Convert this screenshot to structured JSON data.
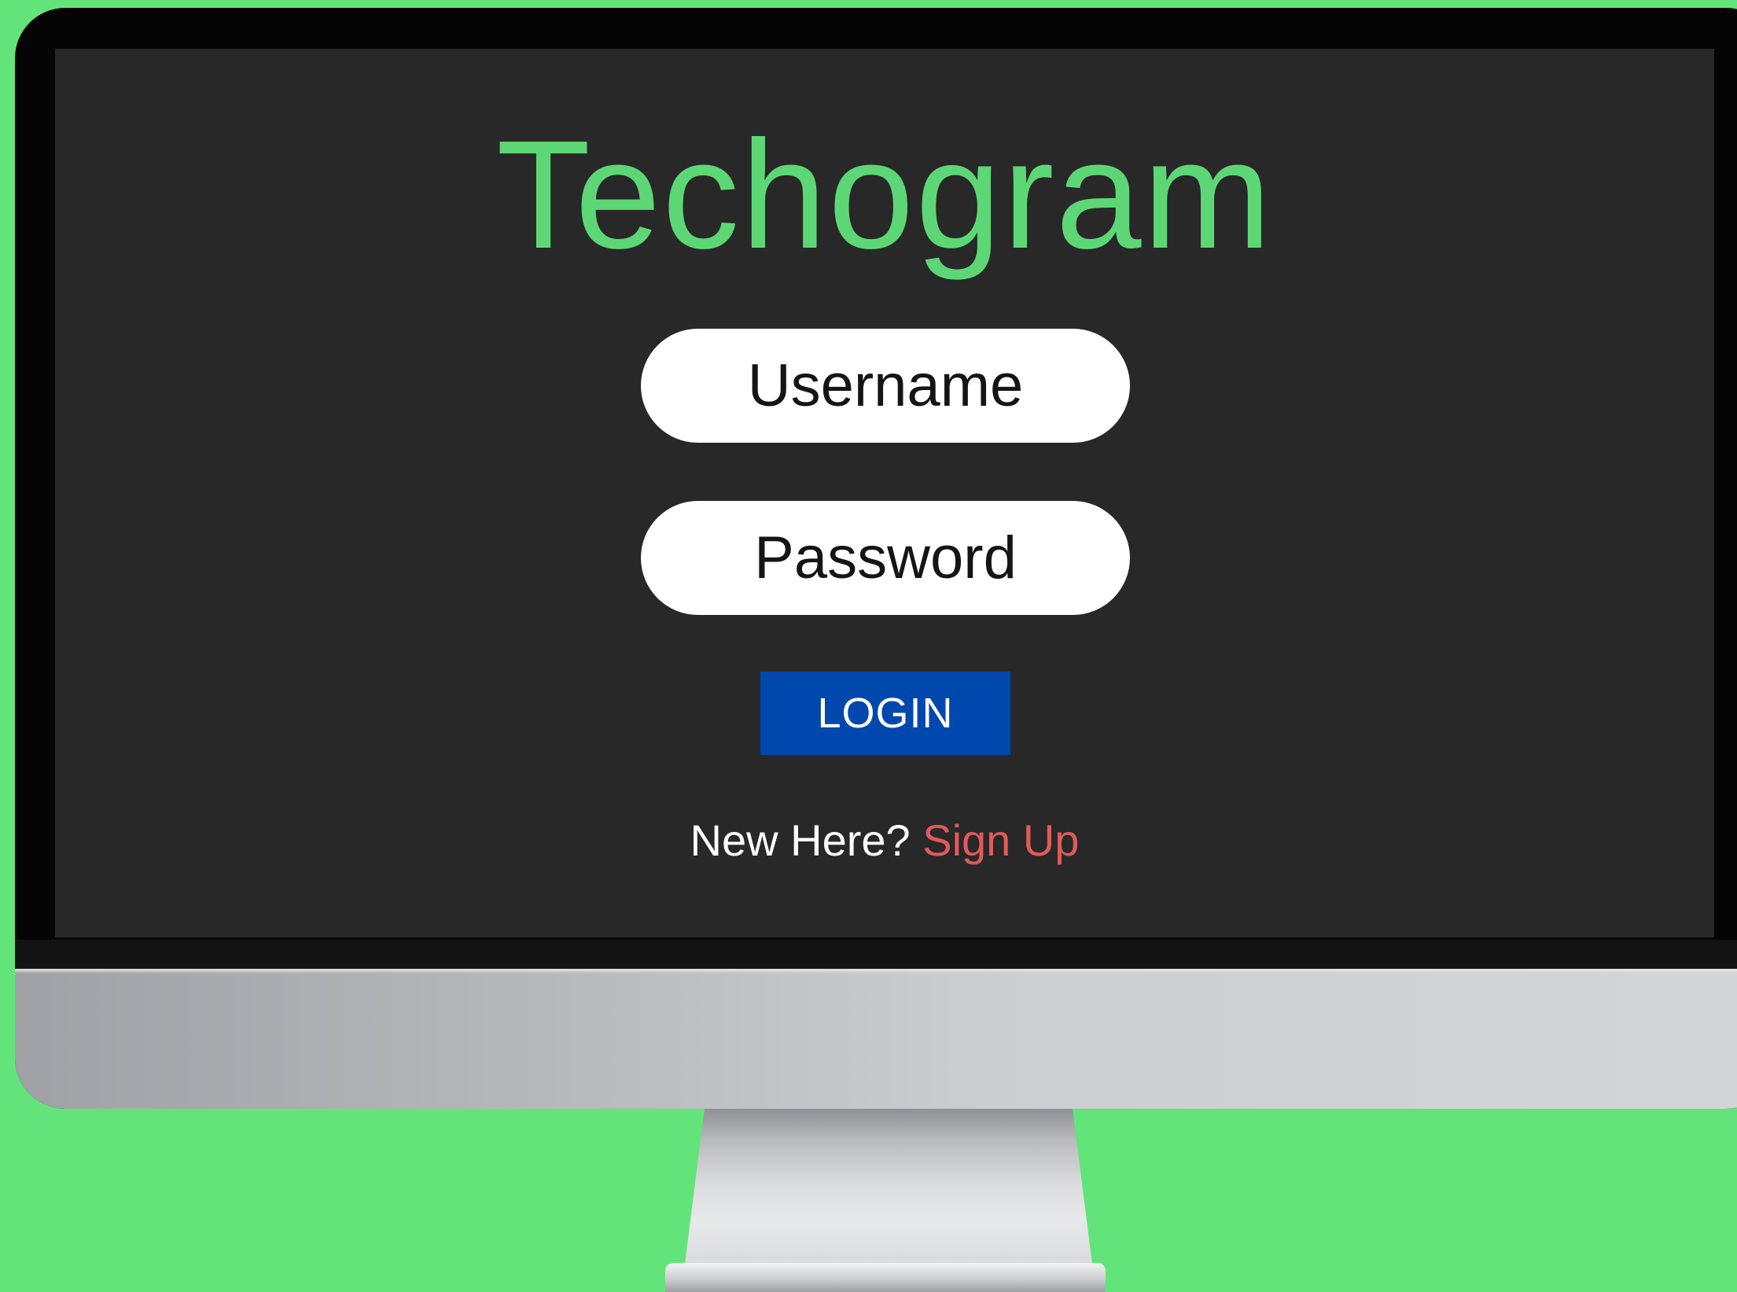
{
  "app": {
    "title": "Techogram"
  },
  "form": {
    "username_placeholder": "Username",
    "password_placeholder": "Password",
    "login_label": "LOGIN"
  },
  "signup": {
    "prompt": "New Here? ",
    "link_label": "Sign Up"
  },
  "colors": {
    "background": "#63e47b",
    "screen": "#282828",
    "title": "#5dd775",
    "login_button": "#0048ad",
    "signup_link": "#e05a5a"
  }
}
